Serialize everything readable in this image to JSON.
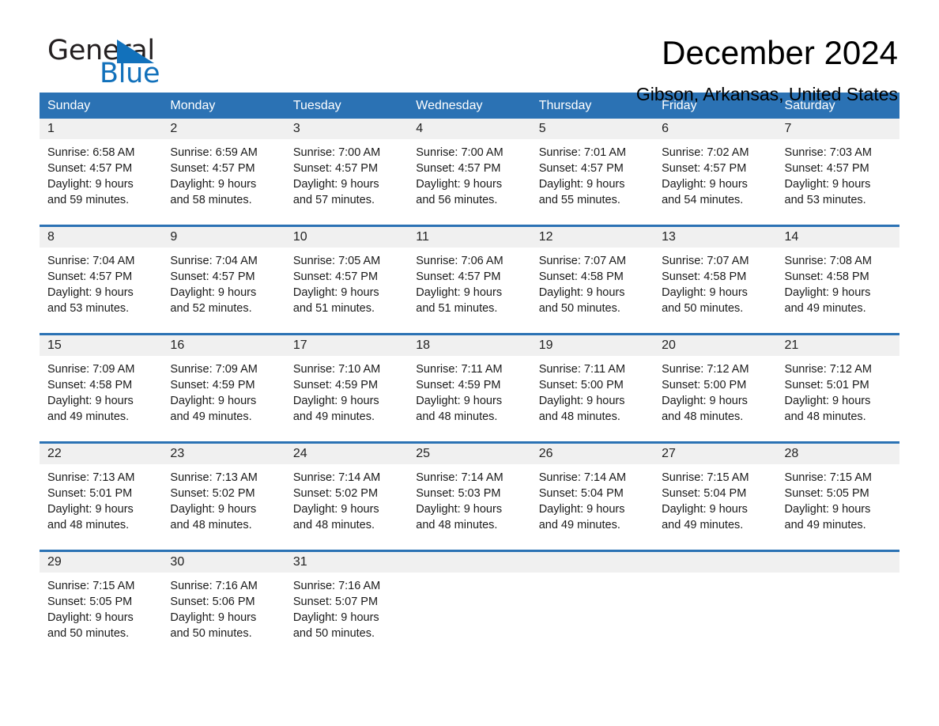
{
  "brand": {
    "name_part1": "General",
    "name_part2": "Blue"
  },
  "header": {
    "month_title": "December 2024",
    "location": "Gibson, Arkansas, United States"
  },
  "colors": {
    "header_blue": "#2b72b4",
    "logo_blue": "#1271bb",
    "day_band_gray": "#f0f0f0"
  },
  "weekdays": [
    "Sunday",
    "Monday",
    "Tuesday",
    "Wednesday",
    "Thursday",
    "Friday",
    "Saturday"
  ],
  "weeks": [
    [
      {
        "day": "1",
        "sunrise": "Sunrise: 6:58 AM",
        "sunset": "Sunset: 4:57 PM",
        "daylight_line1": "Daylight: 9 hours",
        "daylight_line2": "and 59 minutes."
      },
      {
        "day": "2",
        "sunrise": "Sunrise: 6:59 AM",
        "sunset": "Sunset: 4:57 PM",
        "daylight_line1": "Daylight: 9 hours",
        "daylight_line2": "and 58 minutes."
      },
      {
        "day": "3",
        "sunrise": "Sunrise: 7:00 AM",
        "sunset": "Sunset: 4:57 PM",
        "daylight_line1": "Daylight: 9 hours",
        "daylight_line2": "and 57 minutes."
      },
      {
        "day": "4",
        "sunrise": "Sunrise: 7:00 AM",
        "sunset": "Sunset: 4:57 PM",
        "daylight_line1": "Daylight: 9 hours",
        "daylight_line2": "and 56 minutes."
      },
      {
        "day": "5",
        "sunrise": "Sunrise: 7:01 AM",
        "sunset": "Sunset: 4:57 PM",
        "daylight_line1": "Daylight: 9 hours",
        "daylight_line2": "and 55 minutes."
      },
      {
        "day": "6",
        "sunrise": "Sunrise: 7:02 AM",
        "sunset": "Sunset: 4:57 PM",
        "daylight_line1": "Daylight: 9 hours",
        "daylight_line2": "and 54 minutes."
      },
      {
        "day": "7",
        "sunrise": "Sunrise: 7:03 AM",
        "sunset": "Sunset: 4:57 PM",
        "daylight_line1": "Daylight: 9 hours",
        "daylight_line2": "and 53 minutes."
      }
    ],
    [
      {
        "day": "8",
        "sunrise": "Sunrise: 7:04 AM",
        "sunset": "Sunset: 4:57 PM",
        "daylight_line1": "Daylight: 9 hours",
        "daylight_line2": "and 53 minutes."
      },
      {
        "day": "9",
        "sunrise": "Sunrise: 7:04 AM",
        "sunset": "Sunset: 4:57 PM",
        "daylight_line1": "Daylight: 9 hours",
        "daylight_line2": "and 52 minutes."
      },
      {
        "day": "10",
        "sunrise": "Sunrise: 7:05 AM",
        "sunset": "Sunset: 4:57 PM",
        "daylight_line1": "Daylight: 9 hours",
        "daylight_line2": "and 51 minutes."
      },
      {
        "day": "11",
        "sunrise": "Sunrise: 7:06 AM",
        "sunset": "Sunset: 4:57 PM",
        "daylight_line1": "Daylight: 9 hours",
        "daylight_line2": "and 51 minutes."
      },
      {
        "day": "12",
        "sunrise": "Sunrise: 7:07 AM",
        "sunset": "Sunset: 4:58 PM",
        "daylight_line1": "Daylight: 9 hours",
        "daylight_line2": "and 50 minutes."
      },
      {
        "day": "13",
        "sunrise": "Sunrise: 7:07 AM",
        "sunset": "Sunset: 4:58 PM",
        "daylight_line1": "Daylight: 9 hours",
        "daylight_line2": "and 50 minutes."
      },
      {
        "day": "14",
        "sunrise": "Sunrise: 7:08 AM",
        "sunset": "Sunset: 4:58 PM",
        "daylight_line1": "Daylight: 9 hours",
        "daylight_line2": "and 49 minutes."
      }
    ],
    [
      {
        "day": "15",
        "sunrise": "Sunrise: 7:09 AM",
        "sunset": "Sunset: 4:58 PM",
        "daylight_line1": "Daylight: 9 hours",
        "daylight_line2": "and 49 minutes."
      },
      {
        "day": "16",
        "sunrise": "Sunrise: 7:09 AM",
        "sunset": "Sunset: 4:59 PM",
        "daylight_line1": "Daylight: 9 hours",
        "daylight_line2": "and 49 minutes."
      },
      {
        "day": "17",
        "sunrise": "Sunrise: 7:10 AM",
        "sunset": "Sunset: 4:59 PM",
        "daylight_line1": "Daylight: 9 hours",
        "daylight_line2": "and 49 minutes."
      },
      {
        "day": "18",
        "sunrise": "Sunrise: 7:11 AM",
        "sunset": "Sunset: 4:59 PM",
        "daylight_line1": "Daylight: 9 hours",
        "daylight_line2": "and 48 minutes."
      },
      {
        "day": "19",
        "sunrise": "Sunrise: 7:11 AM",
        "sunset": "Sunset: 5:00 PM",
        "daylight_line1": "Daylight: 9 hours",
        "daylight_line2": "and 48 minutes."
      },
      {
        "day": "20",
        "sunrise": "Sunrise: 7:12 AM",
        "sunset": "Sunset: 5:00 PM",
        "daylight_line1": "Daylight: 9 hours",
        "daylight_line2": "and 48 minutes."
      },
      {
        "day": "21",
        "sunrise": "Sunrise: 7:12 AM",
        "sunset": "Sunset: 5:01 PM",
        "daylight_line1": "Daylight: 9 hours",
        "daylight_line2": "and 48 minutes."
      }
    ],
    [
      {
        "day": "22",
        "sunrise": "Sunrise: 7:13 AM",
        "sunset": "Sunset: 5:01 PM",
        "daylight_line1": "Daylight: 9 hours",
        "daylight_line2": "and 48 minutes."
      },
      {
        "day": "23",
        "sunrise": "Sunrise: 7:13 AM",
        "sunset": "Sunset: 5:02 PM",
        "daylight_line1": "Daylight: 9 hours",
        "daylight_line2": "and 48 minutes."
      },
      {
        "day": "24",
        "sunrise": "Sunrise: 7:14 AM",
        "sunset": "Sunset: 5:02 PM",
        "daylight_line1": "Daylight: 9 hours",
        "daylight_line2": "and 48 minutes."
      },
      {
        "day": "25",
        "sunrise": "Sunrise: 7:14 AM",
        "sunset": "Sunset: 5:03 PM",
        "daylight_line1": "Daylight: 9 hours",
        "daylight_line2": "and 48 minutes."
      },
      {
        "day": "26",
        "sunrise": "Sunrise: 7:14 AM",
        "sunset": "Sunset: 5:04 PM",
        "daylight_line1": "Daylight: 9 hours",
        "daylight_line2": "and 49 minutes."
      },
      {
        "day": "27",
        "sunrise": "Sunrise: 7:15 AM",
        "sunset": "Sunset: 5:04 PM",
        "daylight_line1": "Daylight: 9 hours",
        "daylight_line2": "and 49 minutes."
      },
      {
        "day": "28",
        "sunrise": "Sunrise: 7:15 AM",
        "sunset": "Sunset: 5:05 PM",
        "daylight_line1": "Daylight: 9 hours",
        "daylight_line2": "and 49 minutes."
      }
    ],
    [
      {
        "day": "29",
        "sunrise": "Sunrise: 7:15 AM",
        "sunset": "Sunset: 5:05 PM",
        "daylight_line1": "Daylight: 9 hours",
        "daylight_line2": "and 50 minutes."
      },
      {
        "day": "30",
        "sunrise": "Sunrise: 7:16 AM",
        "sunset": "Sunset: 5:06 PM",
        "daylight_line1": "Daylight: 9 hours",
        "daylight_line2": "and 50 minutes."
      },
      {
        "day": "31",
        "sunrise": "Sunrise: 7:16 AM",
        "sunset": "Sunset: 5:07 PM",
        "daylight_line1": "Daylight: 9 hours",
        "daylight_line2": "and 50 minutes."
      },
      {
        "day": "",
        "sunrise": "",
        "sunset": "",
        "daylight_line1": "",
        "daylight_line2": ""
      },
      {
        "day": "",
        "sunrise": "",
        "sunset": "",
        "daylight_line1": "",
        "daylight_line2": ""
      },
      {
        "day": "",
        "sunrise": "",
        "sunset": "",
        "daylight_line1": "",
        "daylight_line2": ""
      },
      {
        "day": "",
        "sunrise": "",
        "sunset": "",
        "daylight_line1": "",
        "daylight_line2": ""
      }
    ]
  ]
}
